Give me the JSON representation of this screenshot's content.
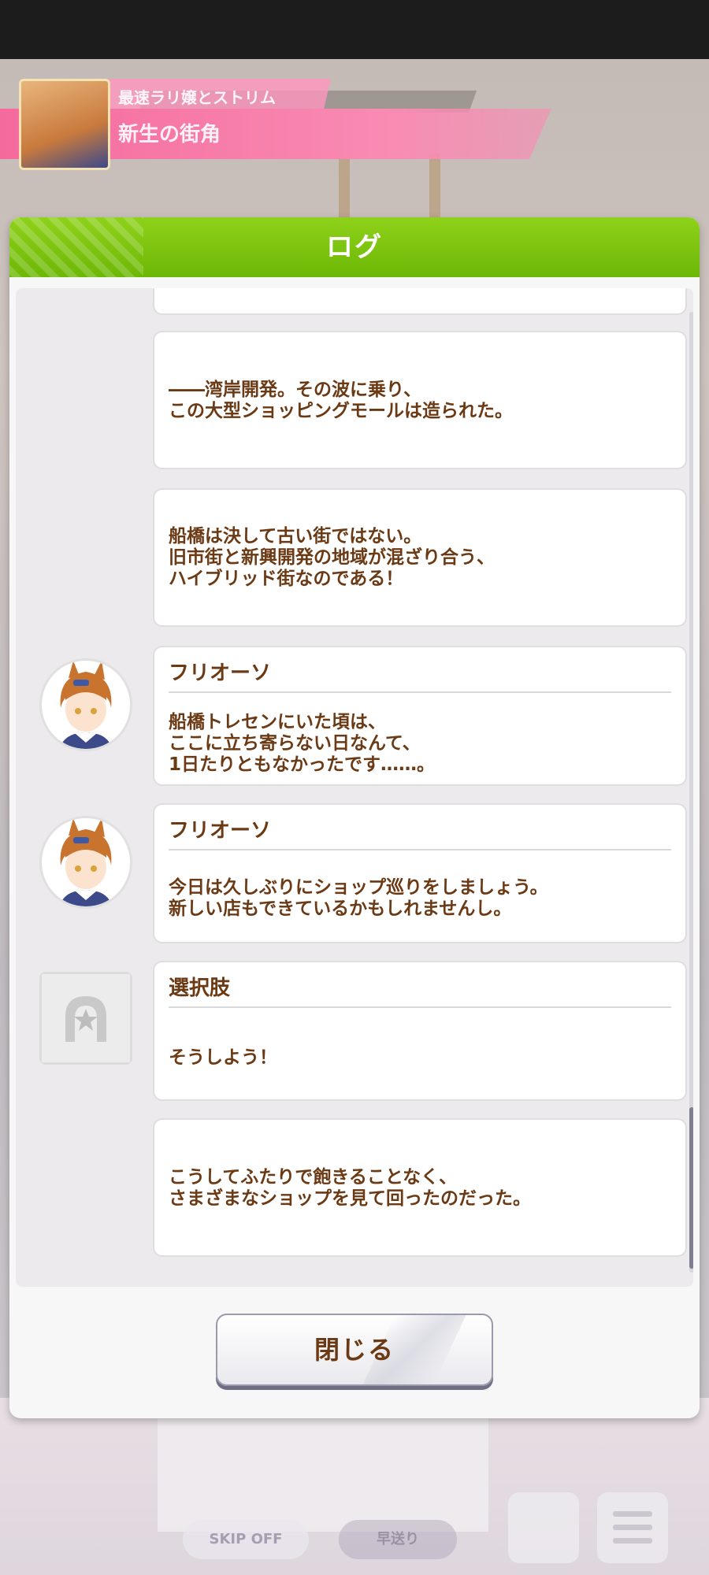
{
  "window": {
    "title": "ログ"
  },
  "name_plate": {
    "subtitle": "最速ラリ嬢とストリム",
    "location": "新生の街角"
  },
  "log_entries": [
    {
      "type": "narration",
      "text": ""
    },
    {
      "type": "narration",
      "text": "――湾岸開発。その波に乗り、\nこの大型ショッピングモールは造られた。"
    },
    {
      "type": "narration",
      "text": "船橋は決して古い街ではない。\n旧市街と新興開発の地域が混ざり合う、\nハイブリッド街なのである！"
    },
    {
      "type": "dialogue",
      "speaker": "フリオーソ",
      "text": "船橋トレセンにいた頃は、\nここに立ち寄らない日なんて、\n1日たりともなかったです……。",
      "avatar": "furioso-portrait"
    },
    {
      "type": "dialogue",
      "speaker": "フリオーソ",
      "text": "今日は久しぶりにショップ巡りをしましょう。\n新しい店もできているかもしれませんし。",
      "avatar": "furioso-portrait"
    },
    {
      "type": "choice",
      "speaker": "選択肢",
      "text": "そうしよう！",
      "avatar": "horseshoe-star-icon"
    },
    {
      "type": "narration",
      "text": "こうしてふたりで飽きることなく、\nさまざまなショップを見て回ったのだった。"
    }
  ],
  "close_button": {
    "label": "閉じる"
  },
  "hud": {
    "skip_label": "SKIP OFF",
    "auto_label": "早送り"
  },
  "colors": {
    "header_green": "#7cc40d",
    "text_brown": "#6b3a14",
    "name_pink": "#f56a9c"
  }
}
